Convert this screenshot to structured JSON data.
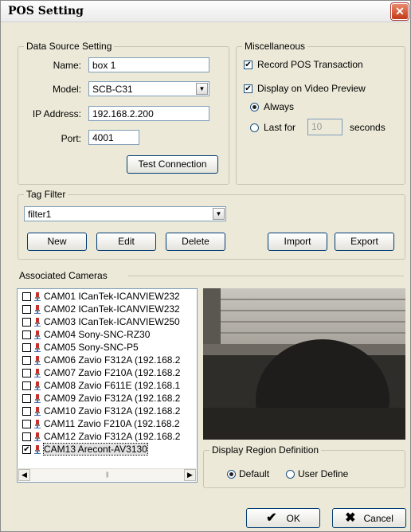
{
  "window": {
    "title": "POS Setting",
    "close_glyph": "✕"
  },
  "data_source": {
    "legend": "Data Source Setting",
    "name_label": "Name:",
    "name_value": "box 1",
    "model_label": "Model:",
    "model_value": "SCB-C31",
    "ip_label": "IP Address:",
    "ip_value": "192.168.2.200",
    "port_label": "Port:",
    "port_value": "4001",
    "test_button": "Test Connection"
  },
  "misc": {
    "legend": "Miscellaneous",
    "record_pos": {
      "label": "Record POS Transaction",
      "checked": true
    },
    "display_preview": {
      "label": "Display on Video Preview",
      "checked": true
    },
    "always_label": "Always",
    "last_for_label": "Last for",
    "last_for_value": "10",
    "seconds_label": "seconds"
  },
  "tag_filter": {
    "legend": "Tag Filter",
    "selected": "filter1",
    "buttons": {
      "new": "New",
      "edit": "Edit",
      "delete": "Delete",
      "import": "Import",
      "export": "Export"
    }
  },
  "associated_cameras": {
    "legend": "Associated Cameras",
    "cameras": [
      {
        "label": "CAM01 ICanTek-ICANVIEW232",
        "checked": false
      },
      {
        "label": "CAM02 ICanTek-ICANVIEW232",
        "checked": false
      },
      {
        "label": "CAM03 ICanTek-ICANVIEW250",
        "checked": false
      },
      {
        "label": "CAM04 Sony-SNC-RZ30",
        "checked": false
      },
      {
        "label": "CAM05 Sony-SNC-P5",
        "checked": false
      },
      {
        "label": "CAM06 Zavio F312A (192.168.2",
        "checked": false
      },
      {
        "label": "CAM07 Zavio F210A (192.168.2",
        "checked": false
      },
      {
        "label": "CAM08 Zavio F611E (192.168.1",
        "checked": false
      },
      {
        "label": "CAM09 Zavio F312A (192.168.2",
        "checked": false
      },
      {
        "label": "CAM10 Zavio F312A (192.168.2",
        "checked": false
      },
      {
        "label": "CAM11 Zavio F210A (192.168.2",
        "checked": false
      },
      {
        "label": "CAM12 Zavio F312A (192.168.2",
        "checked": false
      },
      {
        "label": "CAM13 Arecont-AV3130",
        "checked": true,
        "selected": true
      }
    ]
  },
  "region": {
    "legend": "Display Region Definition",
    "default_label": "Default",
    "user_define_label": "User Define",
    "selected": "Default"
  },
  "footer": {
    "ok": "OK",
    "cancel": "Cancel"
  }
}
